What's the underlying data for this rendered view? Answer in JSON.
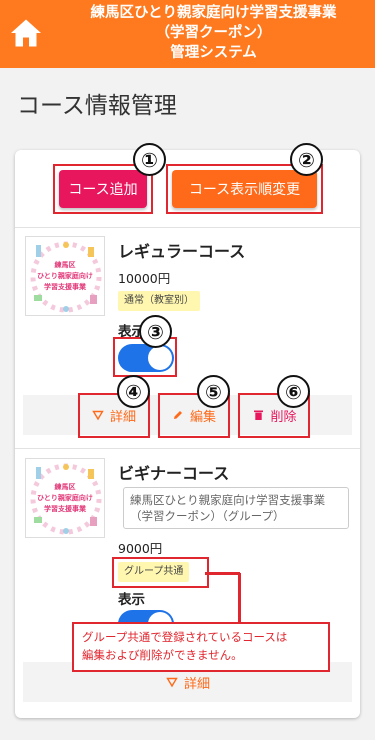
{
  "header": {
    "line1": "練馬区ひとり親家庭向け学習支援事業",
    "line2": "（学習クーポン）",
    "line3": "管理システム"
  },
  "page": {
    "title": "コース情報管理"
  },
  "toolbar": {
    "add_label": "コース追加",
    "order_label": "コース表示順変更"
  },
  "markers": [
    "①",
    "②",
    "③",
    "④",
    "⑤",
    "⑥"
  ],
  "thumbnail": {
    "line1": "練馬区",
    "line2": "ひとり親家庭向け",
    "line3": "学習支援事業"
  },
  "courses": [
    {
      "name": "レギュラーコース",
      "price": "10000円",
      "tag": "通常（教室別）",
      "show_label": "表示",
      "visible": true,
      "actions": {
        "detail": "詳細",
        "edit": "編集",
        "delete": "削除"
      }
    },
    {
      "name": "ビギナーコース",
      "description": "練馬区ひとり親家庭向け学習支援事業（学習クーポン）（グループ）",
      "price": "9000円",
      "tag": "グループ共通",
      "show_label": "表示",
      "visible": true,
      "actions": {
        "detail": "詳細"
      }
    }
  ],
  "notice": {
    "line1": "グループ共通で登録されているコースは",
    "line2": "編集および削除ができません。"
  },
  "colors": {
    "header": "#ff7a1f",
    "add_button": "#e8175d",
    "order_button": "#ff6a1a",
    "toggle_on": "#1e73e8",
    "annotation": "#e0262e"
  },
  "icons": [
    "home-icon",
    "triangle-down-icon",
    "pencil-icon",
    "trash-icon"
  ]
}
